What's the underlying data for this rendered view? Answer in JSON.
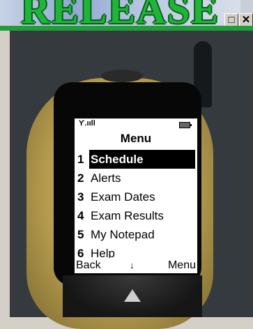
{
  "window": {
    "banner_text": "RELEASE",
    "maximize_glyph": "□",
    "close_glyph": "✕"
  },
  "phone": {
    "status": {
      "signal": "Ƴ.ııll"
    },
    "menu_title": "Menu",
    "menu_items": [
      {
        "number": "1",
        "label": "Schedule",
        "selected": true
      },
      {
        "number": "2",
        "label": "Alerts"
      },
      {
        "number": "3",
        "label": "Exam Dates"
      },
      {
        "number": "4",
        "label": "Exam Results"
      },
      {
        "number": "5",
        "label": "My Notepad"
      },
      {
        "number": "6",
        "label": "Help"
      }
    ],
    "softkeys": {
      "left": "Back",
      "middle": "↓",
      "right": "Menu"
    }
  },
  "colors": {
    "banner_green": "#1fb53a",
    "phone_gold": "#b69c4f",
    "selection": "#000000"
  },
  "icons": [
    "signal-icon",
    "battery-icon",
    "down-arrow-icon",
    "maximize-icon",
    "close-icon"
  ]
}
